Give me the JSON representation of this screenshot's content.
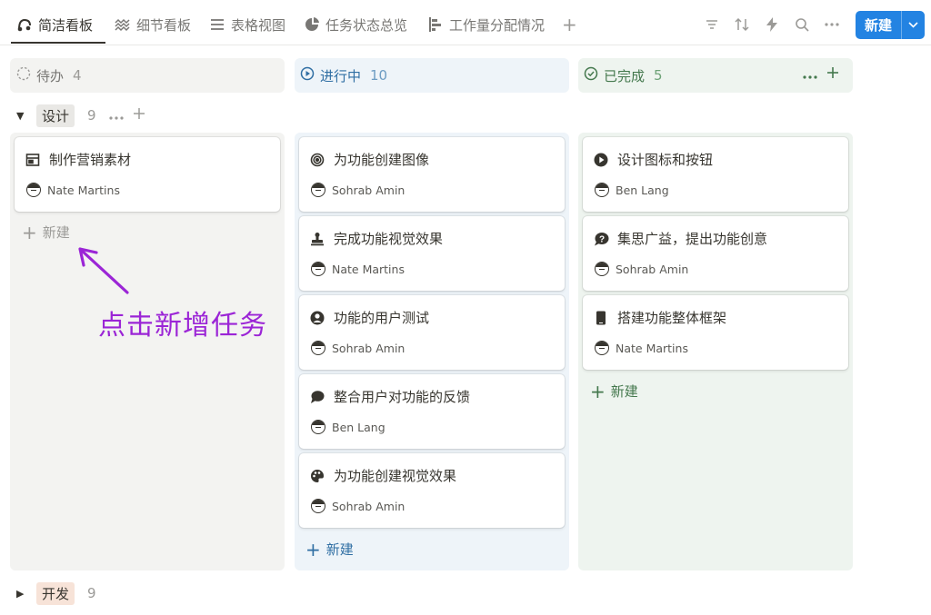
{
  "tabs": [
    {
      "label": "简洁看板",
      "icon": "board-icon"
    },
    {
      "label": "细节看板",
      "icon": "waves-icon"
    },
    {
      "label": "表格视图",
      "icon": "list-icon"
    },
    {
      "label": "任务状态总览",
      "icon": "pie-icon"
    },
    {
      "label": "工作量分配情况",
      "icon": "bar-chart-icon"
    }
  ],
  "toolbar": {
    "new_label": "新建"
  },
  "columns": [
    {
      "label": "待办",
      "count": "4"
    },
    {
      "label": "进行中",
      "count": "10"
    },
    {
      "label": "已完成",
      "count": "5"
    }
  ],
  "groups": [
    {
      "label": "设计",
      "count": "9"
    },
    {
      "label": "开发",
      "count": "9"
    }
  ],
  "cards": {
    "todo": [
      {
        "title": "制作营销素材",
        "icon": "newspaper-icon",
        "person": "Nate Martins"
      }
    ],
    "in_progress": [
      {
        "title": "为功能创建图像",
        "icon": "target-icon",
        "person": "Sohrab Amin"
      },
      {
        "title": "完成功能视觉效果",
        "icon": "stamp-icon",
        "person": "Nate Martins"
      },
      {
        "title": "功能的用户测试",
        "icon": "user-circle-icon",
        "person": "Sohrab Amin"
      },
      {
        "title": "整合用户对功能的反馈",
        "icon": "chat-bubble-icon",
        "person": "Ben Lang"
      },
      {
        "title": "为功能创建视觉效果",
        "icon": "palette-icon",
        "person": "Sohrab Amin"
      }
    ],
    "done": [
      {
        "title": "设计图标和按钮",
        "icon": "play-circle-icon",
        "person": "Ben Lang"
      },
      {
        "title": "集思广益，提出功能创意",
        "icon": "question-bubble-icon",
        "person": "Sohrab Amin"
      },
      {
        "title": "搭建功能整体框架",
        "icon": "phone-icon",
        "person": "Nate Martins"
      }
    ]
  },
  "new_item_label": "新建",
  "annotation": {
    "text": "点击新增任务",
    "color": "#9b25d6"
  },
  "colors": {
    "accent": "#2383e2",
    "in_progress": "#2f6ea3",
    "done": "#44784d"
  }
}
